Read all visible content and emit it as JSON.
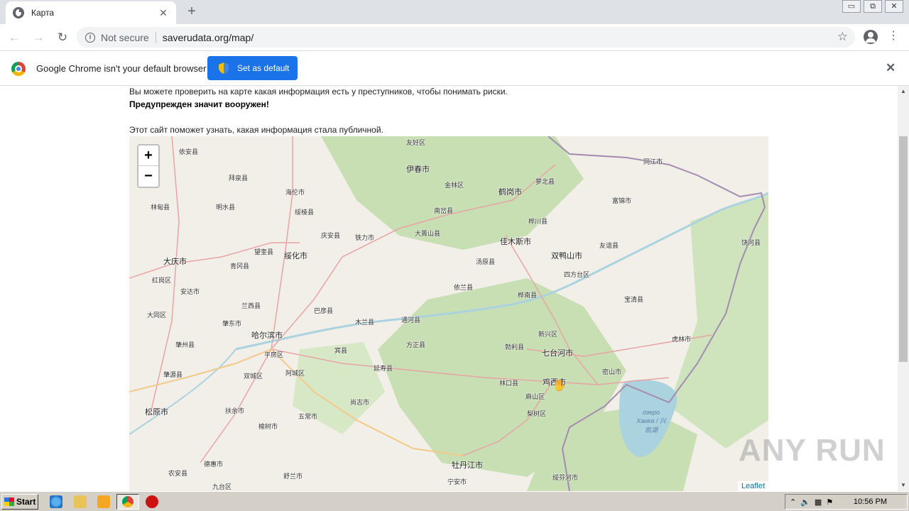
{
  "browser": {
    "tab_title": "Карта",
    "tab_close": "✕",
    "new_tab": "+",
    "security_label": "Not secure",
    "url": "saverudata.org/map/",
    "win_minimize": "▭",
    "win_restore": "⧉",
    "win_close": "✕"
  },
  "infobar": {
    "message": "Google Chrome isn't your default browser",
    "button_label": "Set as default",
    "close": "✕"
  },
  "page": {
    "line1": "Вы можете проверить на карте какая информация есть у преступников, чтобы понимать риски.",
    "line2": "Предупрежден значит вооружен!",
    "line3": "Этот сайт поможет узнать, какая информация стала публичной."
  },
  "map": {
    "zoom_in": "+",
    "zoom_out": "−",
    "attribution": "Leaflet",
    "cities": [
      {
        "name": "友好区"
      },
      {
        "name": "伊春市"
      },
      {
        "name": "金林区"
      },
      {
        "name": "鹤岗市"
      },
      {
        "name": "萝北县"
      },
      {
        "name": "同江市"
      },
      {
        "name": "依安县"
      },
      {
        "name": "拜泉县"
      },
      {
        "name": "海伦市"
      },
      {
        "name": "林甸县"
      },
      {
        "name": "明水县"
      },
      {
        "name": "绥棱县"
      },
      {
        "name": "南岔县"
      },
      {
        "name": "桦川县"
      },
      {
        "name": "富锦市"
      },
      {
        "name": "庆安县"
      },
      {
        "name": "铁力市"
      },
      {
        "name": "大箐山县"
      },
      {
        "name": "佳木斯市"
      },
      {
        "name": "友谊县"
      },
      {
        "name": "饶河县"
      },
      {
        "name": "望奎县"
      },
      {
        "name": "绥化市"
      },
      {
        "name": "双鸭山市"
      },
      {
        "name": "大庆市"
      },
      {
        "name": "青冈县"
      },
      {
        "name": "汤原县"
      },
      {
        "name": "四方台区"
      },
      {
        "name": "红岗区"
      },
      {
        "name": "安达市"
      },
      {
        "name": "依兰县"
      },
      {
        "name": "桦南县"
      },
      {
        "name": "宝清县"
      },
      {
        "name": "兰西县"
      },
      {
        "name": "巴彦县"
      },
      {
        "name": "大同区"
      },
      {
        "name": "肇东市"
      },
      {
        "name": "木兰县"
      },
      {
        "name": "通河县"
      },
      {
        "name": "新兴区"
      },
      {
        "name": "哈尔滨市"
      },
      {
        "name": "肇州县"
      },
      {
        "name": "方正县"
      },
      {
        "name": "勃利县"
      },
      {
        "name": "七台河市"
      },
      {
        "name": "虎林市"
      },
      {
        "name": "平房区"
      },
      {
        "name": "宾县"
      },
      {
        "name": "肇源县"
      },
      {
        "name": "双城区"
      },
      {
        "name": "阿城区"
      },
      {
        "name": "延寿县"
      },
      {
        "name": "密山市"
      },
      {
        "name": "林口县"
      },
      {
        "name": "鸡西市"
      },
      {
        "name": "麻山区"
      },
      {
        "name": "尚志市"
      },
      {
        "name": "松原市"
      },
      {
        "name": "扶余市"
      },
      {
        "name": "五常市"
      },
      {
        "name": "梨树区"
      },
      {
        "name": "榆树市"
      },
      {
        "name": "牡丹江市"
      },
      {
        "name": "德惠市"
      },
      {
        "name": "农安县"
      },
      {
        "name": "舒兰市"
      },
      {
        "name": "绥芬河市"
      },
      {
        "name": "九台区"
      },
      {
        "name": "宁安市"
      }
    ],
    "lake_label": "озеро Ханка / 兴凯湖"
  },
  "watermark": "ANY RUN",
  "taskbar": {
    "start_label": "Start",
    "clock": "10:56 PM"
  }
}
